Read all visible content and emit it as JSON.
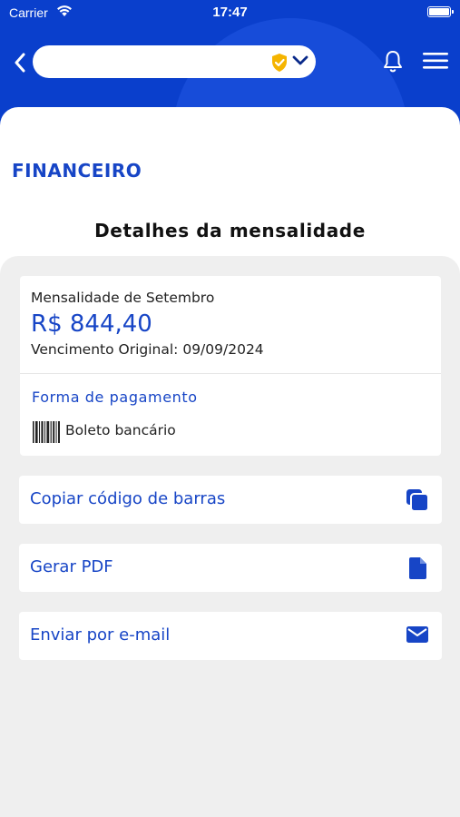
{
  "status_bar": {
    "carrier": "Carrier",
    "time": "17:47"
  },
  "header": {
    "selector_value": "",
    "icons": {
      "back": "chevron-left-icon",
      "shield": "shield-check-icon",
      "dropdown": "chevron-down-icon",
      "bell": "bell-icon",
      "menu": "hamburger-menu-icon"
    }
  },
  "section": {
    "title": "FINANCEIRO"
  },
  "page": {
    "title": "Detalhes da mensalidade"
  },
  "details": {
    "month_label": "Mensalidade de Setembro",
    "amount": "R$ 844,40",
    "due_date": "Vencimento Original: 09/09/2024",
    "payment_label": "Forma de pagamento",
    "payment_method": "Boleto bancário"
  },
  "actions": [
    {
      "label": "Copiar código de barras",
      "icon": "copy-icon"
    },
    {
      "label": "Gerar PDF",
      "icon": "file-icon"
    },
    {
      "label": "Enviar por e-mail",
      "icon": "envelope-icon"
    }
  ],
  "colors": {
    "header_blue": "#0a3fcc",
    "accent_blue": "#1745c6",
    "shield_yellow": "#f5b400",
    "panel_gray": "#efefef"
  }
}
